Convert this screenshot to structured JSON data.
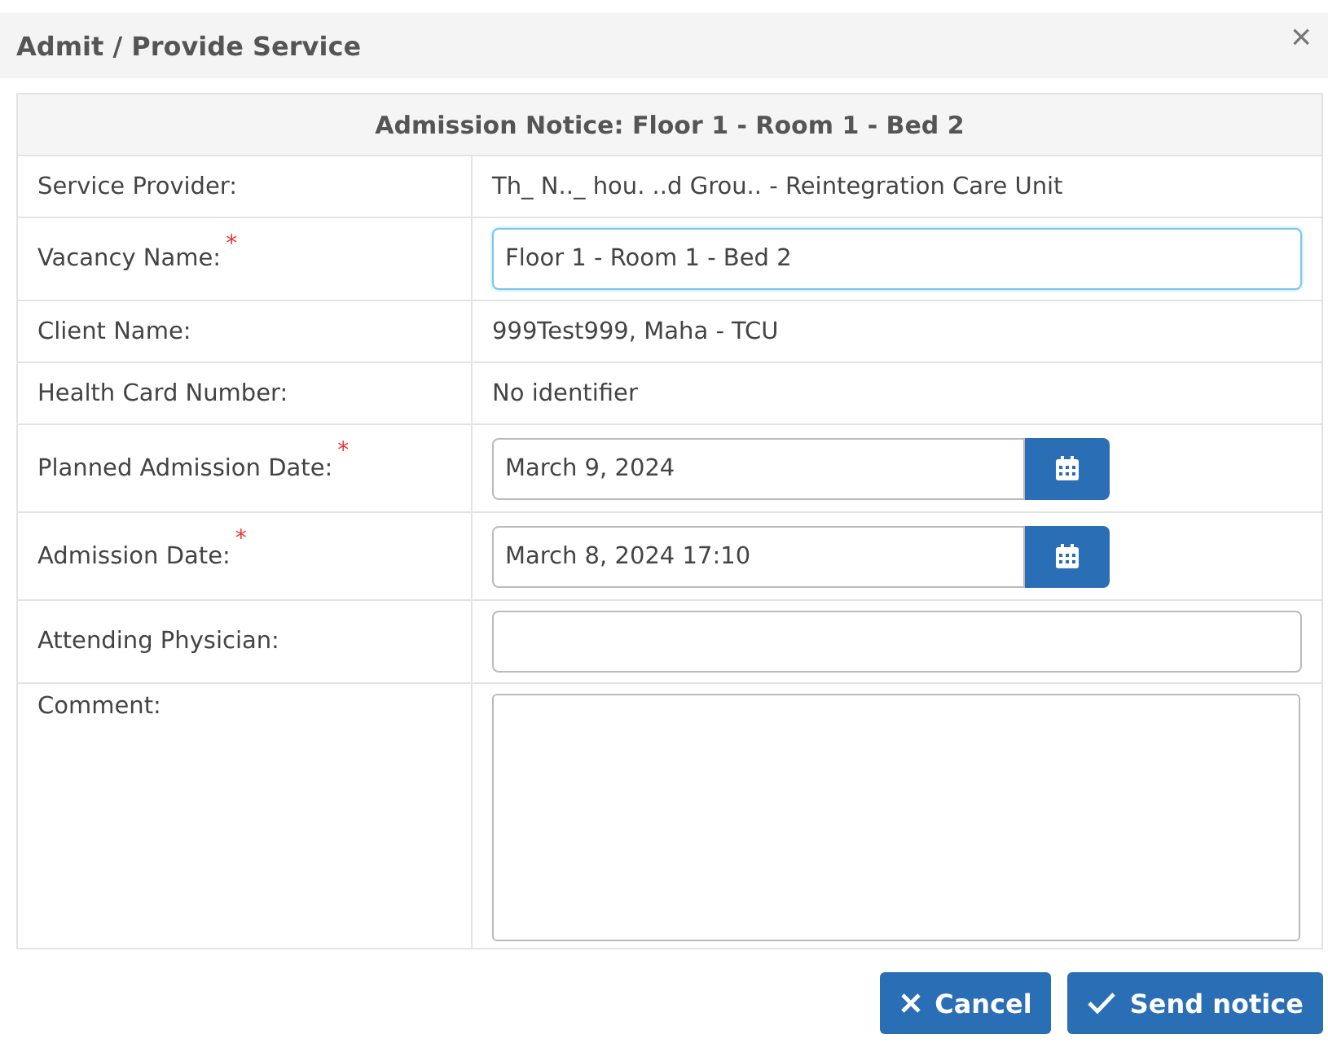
{
  "dialog": {
    "title": "Admit / Provide Service",
    "close": "×"
  },
  "table": {
    "heading": "Admission Notice: Floor 1 - Room 1 - Bed 2",
    "rows": [
      {
        "kind": "text",
        "label": "Service Provider:",
        "required": false,
        "value": "Th_ N.._ hou.   ..d Grou.. - Reintegration Care Unit"
      },
      {
        "kind": "input",
        "label": "Vacancy Name:",
        "required": true,
        "value": "Floor 1 - Room 1 - Bed 2",
        "focused": true
      },
      {
        "kind": "text",
        "label": "Client Name:",
        "required": false,
        "value": "999Test999, Maha - TCU"
      },
      {
        "kind": "text",
        "label": "Health Card Number:",
        "required": false,
        "value": "No identifier"
      },
      {
        "kind": "date",
        "label": "Planned Admission Date:",
        "required": true,
        "value": "March 9, 2024"
      },
      {
        "kind": "date",
        "label": "Admission Date:",
        "required": true,
        "value": "March 8, 2024 17:10"
      },
      {
        "kind": "input",
        "label": "Attending Physician:",
        "required": false,
        "value": "",
        "focused": false
      },
      {
        "kind": "textarea",
        "label": "Comment:",
        "required": false
      }
    ]
  },
  "required_mark": "*",
  "buttons": [
    {
      "kind": "cancel",
      "label": "Cancel"
    },
    {
      "kind": "send",
      "label": "Send notice"
    }
  ]
}
